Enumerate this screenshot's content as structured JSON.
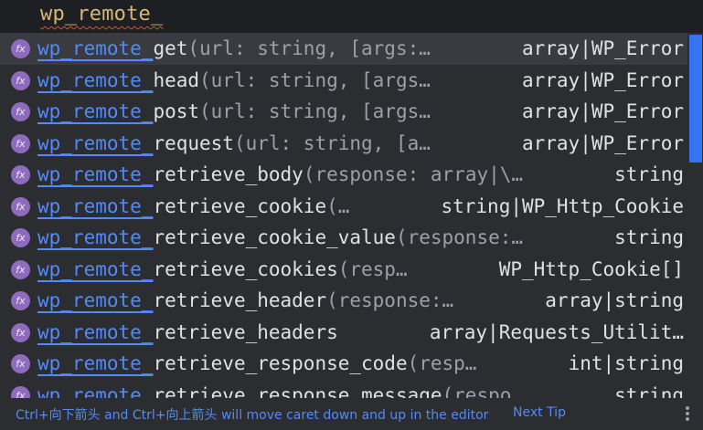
{
  "editor": {
    "typed_text": "wp_remote_"
  },
  "completion": {
    "match_prefix": "wp_remote_",
    "icon_label": "fx",
    "items": [
      {
        "rest": "get",
        "params": "(url: string, [args:…",
        "return_type": "array|WP_Error",
        "selected": true
      },
      {
        "rest": "head",
        "params": "(url: string, [args…",
        "return_type": "array|WP_Error",
        "selected": false
      },
      {
        "rest": "post",
        "params": "(url: string, [args…",
        "return_type": "array|WP_Error",
        "selected": false
      },
      {
        "rest": "request",
        "params": "(url: string, [a…",
        "return_type": "array|WP_Error",
        "selected": false
      },
      {
        "rest": "retrieve_body",
        "params": "(response: array|\\…",
        "return_type": "string",
        "selected": false
      },
      {
        "rest": "retrieve_cookie",
        "params": "(…",
        "return_type": "string|WP_Http_Cookie",
        "selected": false
      },
      {
        "rest": "retrieve_cookie_value",
        "params": "(response:…",
        "return_type": "string",
        "selected": false
      },
      {
        "rest": "retrieve_cookies",
        "params": "(resp…",
        "return_type": "WP_Http_Cookie[]",
        "selected": false
      },
      {
        "rest": "retrieve_header",
        "params": "(response:…",
        "return_type": "array|string",
        "selected": false
      },
      {
        "rest": "retrieve_headers",
        "params": "",
        "return_type": "array|Requests_Utilit…",
        "selected": false
      },
      {
        "rest": "retrieve_response_code",
        "params": "(resp…",
        "return_type": "int|string",
        "selected": false
      },
      {
        "rest": "retrieve_response_message",
        "params": "(respo…",
        "return_type": "string",
        "selected": false
      }
    ]
  },
  "footer": {
    "tip": "Ctrl+向下箭头 and Ctrl+向上箭头 will move caret down and up in the editor",
    "next_tip": "Next Tip"
  },
  "colors": {
    "accent": "#548af7",
    "selection": "#393b40",
    "background": "#2b2d30",
    "function_icon": "#8f6bbd",
    "typed_text": "#d5b778"
  },
  "icons": {
    "function": "fx-function-icon",
    "more": "more-vertical-icon"
  }
}
